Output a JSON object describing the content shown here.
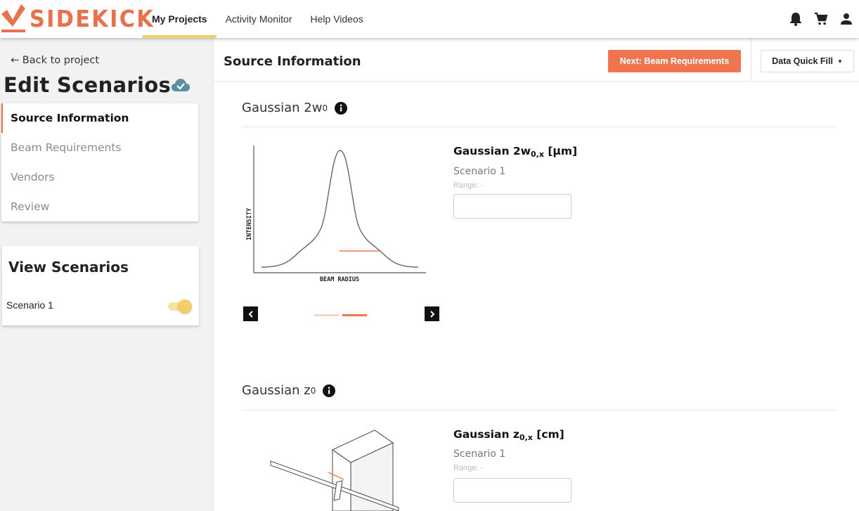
{
  "brand": {
    "name": "SIDEKICK",
    "accent": "#e8704b",
    "highlight": "#f2ce67"
  },
  "nav": {
    "items": [
      {
        "label": "My Projects",
        "active": true
      },
      {
        "label": "Activity Monitor"
      },
      {
        "label": "Help Videos"
      }
    ]
  },
  "top_icons": [
    "bell-icon",
    "cart-icon",
    "user-icon"
  ],
  "sidebar": {
    "back_label": "← Back to project",
    "title": "Edit Scenarios",
    "steps": [
      {
        "label": "Source Information",
        "active": true
      },
      {
        "label": "Beam Requirements"
      },
      {
        "label": "Vendors"
      },
      {
        "label": "Review"
      }
    ],
    "scenarios": {
      "title": "View Scenarios",
      "items": [
        {
          "label": "Scenario 1",
          "enabled": true
        }
      ]
    }
  },
  "main": {
    "title": "Source Information",
    "next_button": "Next: Beam Requirements",
    "quick_fill_button": "Data Quick Fill",
    "sections": [
      {
        "title": "Gaussian 2w",
        "title_sub": "0",
        "plot": {
          "ylabel": "INTENSITY",
          "xlabel": "BEAM RADIUS"
        },
        "field": {
          "label": "Gaussian 2w",
          "label_sub": "0,x",
          "unit": "[μm]",
          "scenario": "Scenario 1",
          "range": "Range: -",
          "value": ""
        },
        "carousel": {
          "slides": 2,
          "current": 2
        }
      },
      {
        "title": "Gaussian z",
        "title_sub": "0",
        "field": {
          "label": "Gaussian z",
          "label_sub": "0,x",
          "unit": "[cm]",
          "scenario": "Scenario 1",
          "range": "Range: -",
          "value": ""
        }
      }
    ]
  }
}
